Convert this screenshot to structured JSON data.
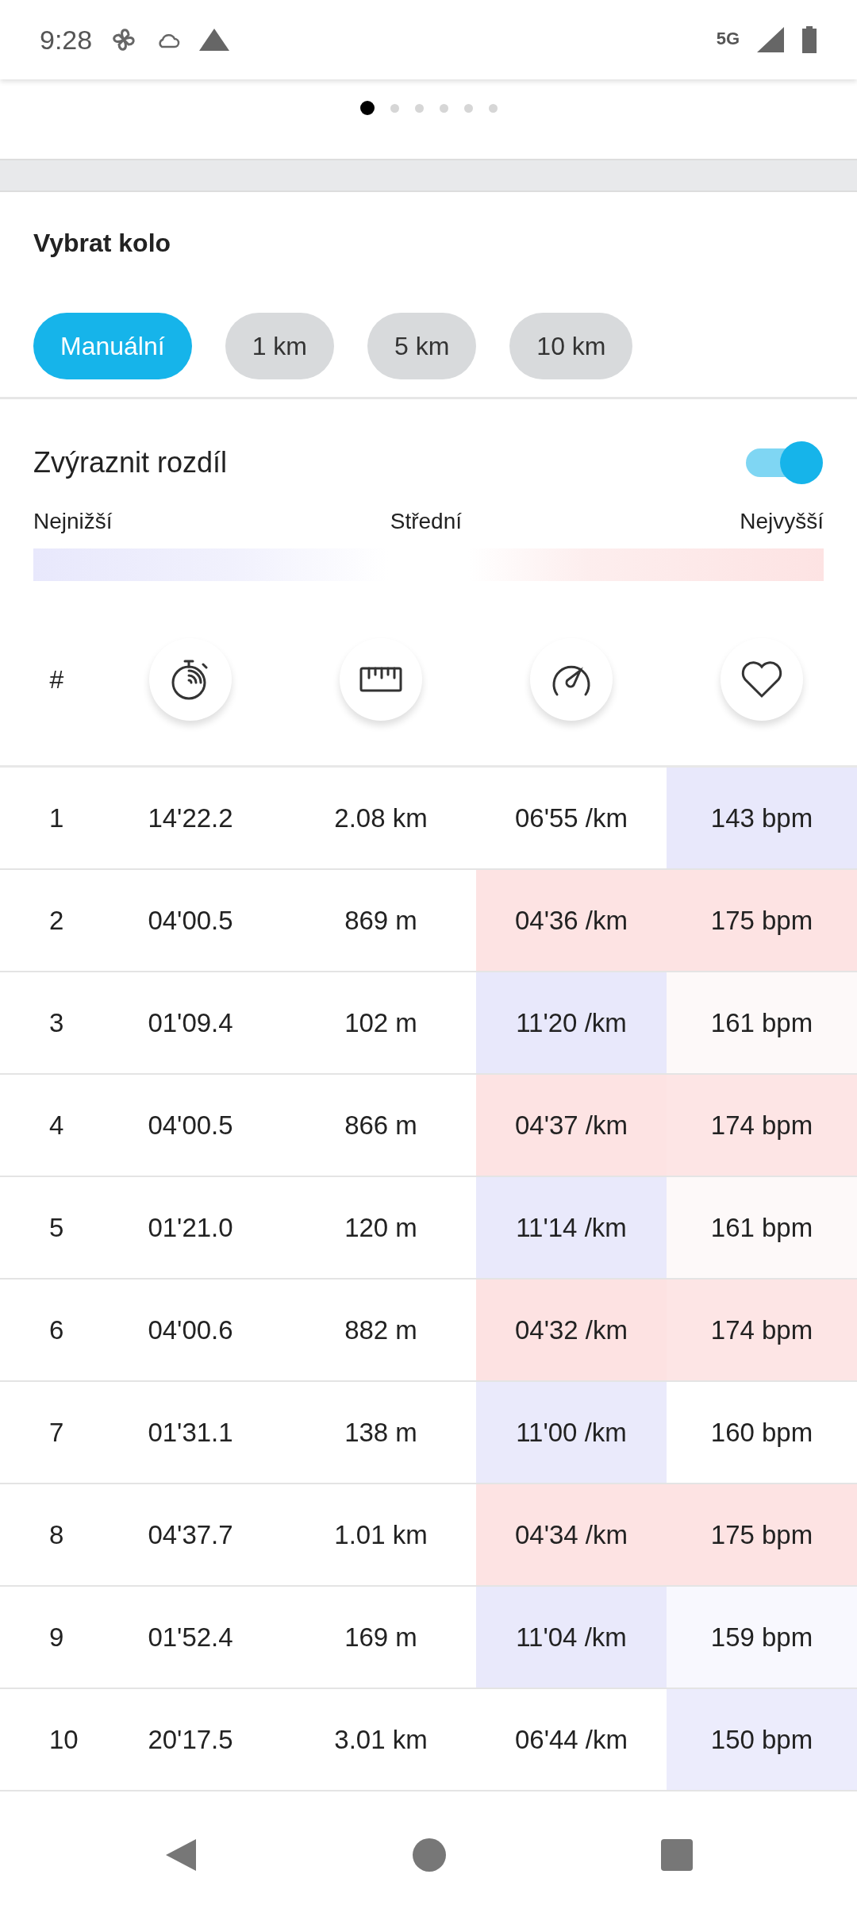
{
  "status_bar": {
    "time": "9:28",
    "network": "5G"
  },
  "pager": {
    "pages": [
      {
        "selected": true
      },
      {
        "selected": false
      },
      {
        "selected": false
      },
      {
        "selected": false
      },
      {
        "selected": false
      },
      {
        "selected": false
      }
    ]
  },
  "lap_picker": {
    "title": "Vybrat kolo",
    "options": [
      {
        "label": "Manuální",
        "selected": true
      },
      {
        "label": "1 km",
        "selected": false
      },
      {
        "label": "5 km",
        "selected": false
      },
      {
        "label": "10 km",
        "selected": false
      }
    ]
  },
  "highlight": {
    "label": "Zvýraznit rozdíl",
    "on": true,
    "legend": [
      "Nejnižší",
      "Střední",
      "Nejvyšší"
    ]
  },
  "table": {
    "columns": [
      {
        "kind": "text",
        "label": "#"
      },
      {
        "kind": "stopwatch"
      },
      {
        "kind": "ruler"
      },
      {
        "kind": "speedometer"
      },
      {
        "kind": "heart"
      }
    ],
    "rows": [
      [
        {
          "text": "1"
        },
        {
          "text": "14'22.2"
        },
        {
          "text": "2.08 km"
        },
        {
          "text": "06'55 /km",
          "color": "#ffffff"
        },
        {
          "text": "143 bpm",
          "color": "#e8e8fb"
        }
      ],
      [
        {
          "text": "2"
        },
        {
          "text": "04'00.5"
        },
        {
          "text": "869 m"
        },
        {
          "text": "04'36 /km",
          "color": "#fde3e3"
        },
        {
          "text": "175 bpm",
          "color": "#fde3e3"
        }
      ],
      [
        {
          "text": "3"
        },
        {
          "text": "01'09.4"
        },
        {
          "text": "102 m"
        },
        {
          "text": "11'20 /km",
          "color": "#e8e8fb"
        },
        {
          "text": "161 bpm",
          "color": "#fdf9f9"
        }
      ],
      [
        {
          "text": "4"
        },
        {
          "text": "04'00.5"
        },
        {
          "text": "866 m"
        },
        {
          "text": "04'37 /km",
          "color": "#fde3e3"
        },
        {
          "text": "174 bpm",
          "color": "#fde5e5"
        }
      ],
      [
        {
          "text": "5"
        },
        {
          "text": "01'21.0"
        },
        {
          "text": "120 m"
        },
        {
          "text": "11'14 /km",
          "color": "#e9e9fb"
        },
        {
          "text": "161 bpm",
          "color": "#fdf9f9"
        }
      ],
      [
        {
          "text": "6"
        },
        {
          "text": "04'00.6"
        },
        {
          "text": "882 m"
        },
        {
          "text": "04'32 /km",
          "color": "#fde2e2"
        },
        {
          "text": "174 bpm",
          "color": "#fde5e5"
        }
      ],
      [
        {
          "text": "7"
        },
        {
          "text": "01'31.1"
        },
        {
          "text": "138 m"
        },
        {
          "text": "11'00 /km",
          "color": "#eaeafb"
        },
        {
          "text": "160 bpm",
          "color": "#ffffff"
        }
      ],
      [
        {
          "text": "8"
        },
        {
          "text": "04'37.7"
        },
        {
          "text": "1.01 km"
        },
        {
          "text": "04'34 /km",
          "color": "#fde3e3"
        },
        {
          "text": "175 bpm",
          "color": "#fde3e3"
        }
      ],
      [
        {
          "text": "9"
        },
        {
          "text": "01'52.4"
        },
        {
          "text": "169 m"
        },
        {
          "text": "11'04 /km",
          "color": "#e9e9fb"
        },
        {
          "text": "159 bpm",
          "color": "#f8f8fe"
        }
      ],
      [
        {
          "text": "10"
        },
        {
          "text": "20'17.5"
        },
        {
          "text": "3.01 km"
        },
        {
          "text": "06'44 /km",
          "color": "#ffffff"
        },
        {
          "text": "150 bpm",
          "color": "#ececfc"
        }
      ]
    ]
  }
}
